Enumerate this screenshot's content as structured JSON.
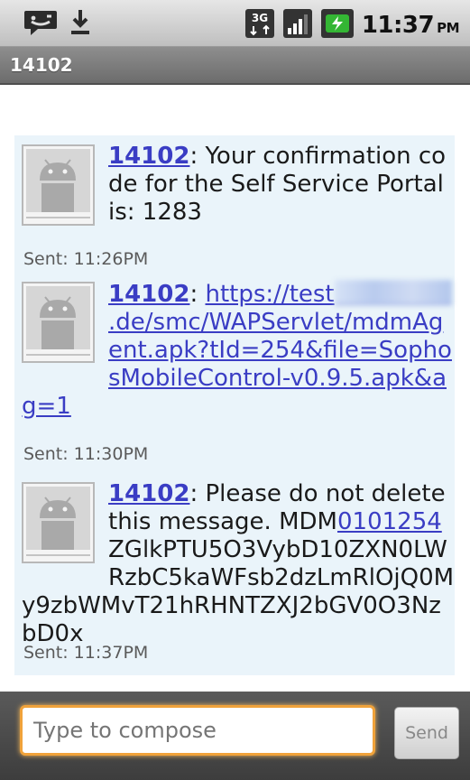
{
  "status_bar": {
    "time": "11:37",
    "ampm": "PM",
    "network": "3G",
    "icons": [
      "sms-notification-icon",
      "download-icon",
      "3g-icon",
      "signal-icon",
      "battery-charging-icon"
    ]
  },
  "title_bar": {
    "title": "14102"
  },
  "messages": [
    {
      "sender": "14102",
      "separator": ":",
      "text": " Your confirmation code for the Self Service Portal is: 1283",
      "sent": "Sent: 11:26PM"
    },
    {
      "sender": "14102",
      "separator": ":",
      "link_start": "https://test",
      "link_end": ".de/smc/WAPServlet/mdmAgent.apk?tId=254&file=SophosMobileControl-v0.9.5.apk&ag=1",
      "sent": "Sent: 11:30PM"
    },
    {
      "sender": "14102",
      "separator": ":",
      "text_before": " Please do not delete this message. MDM",
      "link": "0101254",
      "text_after": "ZGlkPTU5O3VybD10ZXN0LWRzbC5kaWFsb2dzLmRlOjQ0My9zbWMvT21hRHNTZXJ2bGV0O3NzbD0x",
      "sent": "Sent: 11:37PM"
    }
  ],
  "compose": {
    "placeholder": "Type to compose",
    "send_label": "Send"
  },
  "colors": {
    "conversation_bg": "#eaf4fa",
    "link": "#3a3dc4",
    "compose_focus": "#f0a23a"
  }
}
